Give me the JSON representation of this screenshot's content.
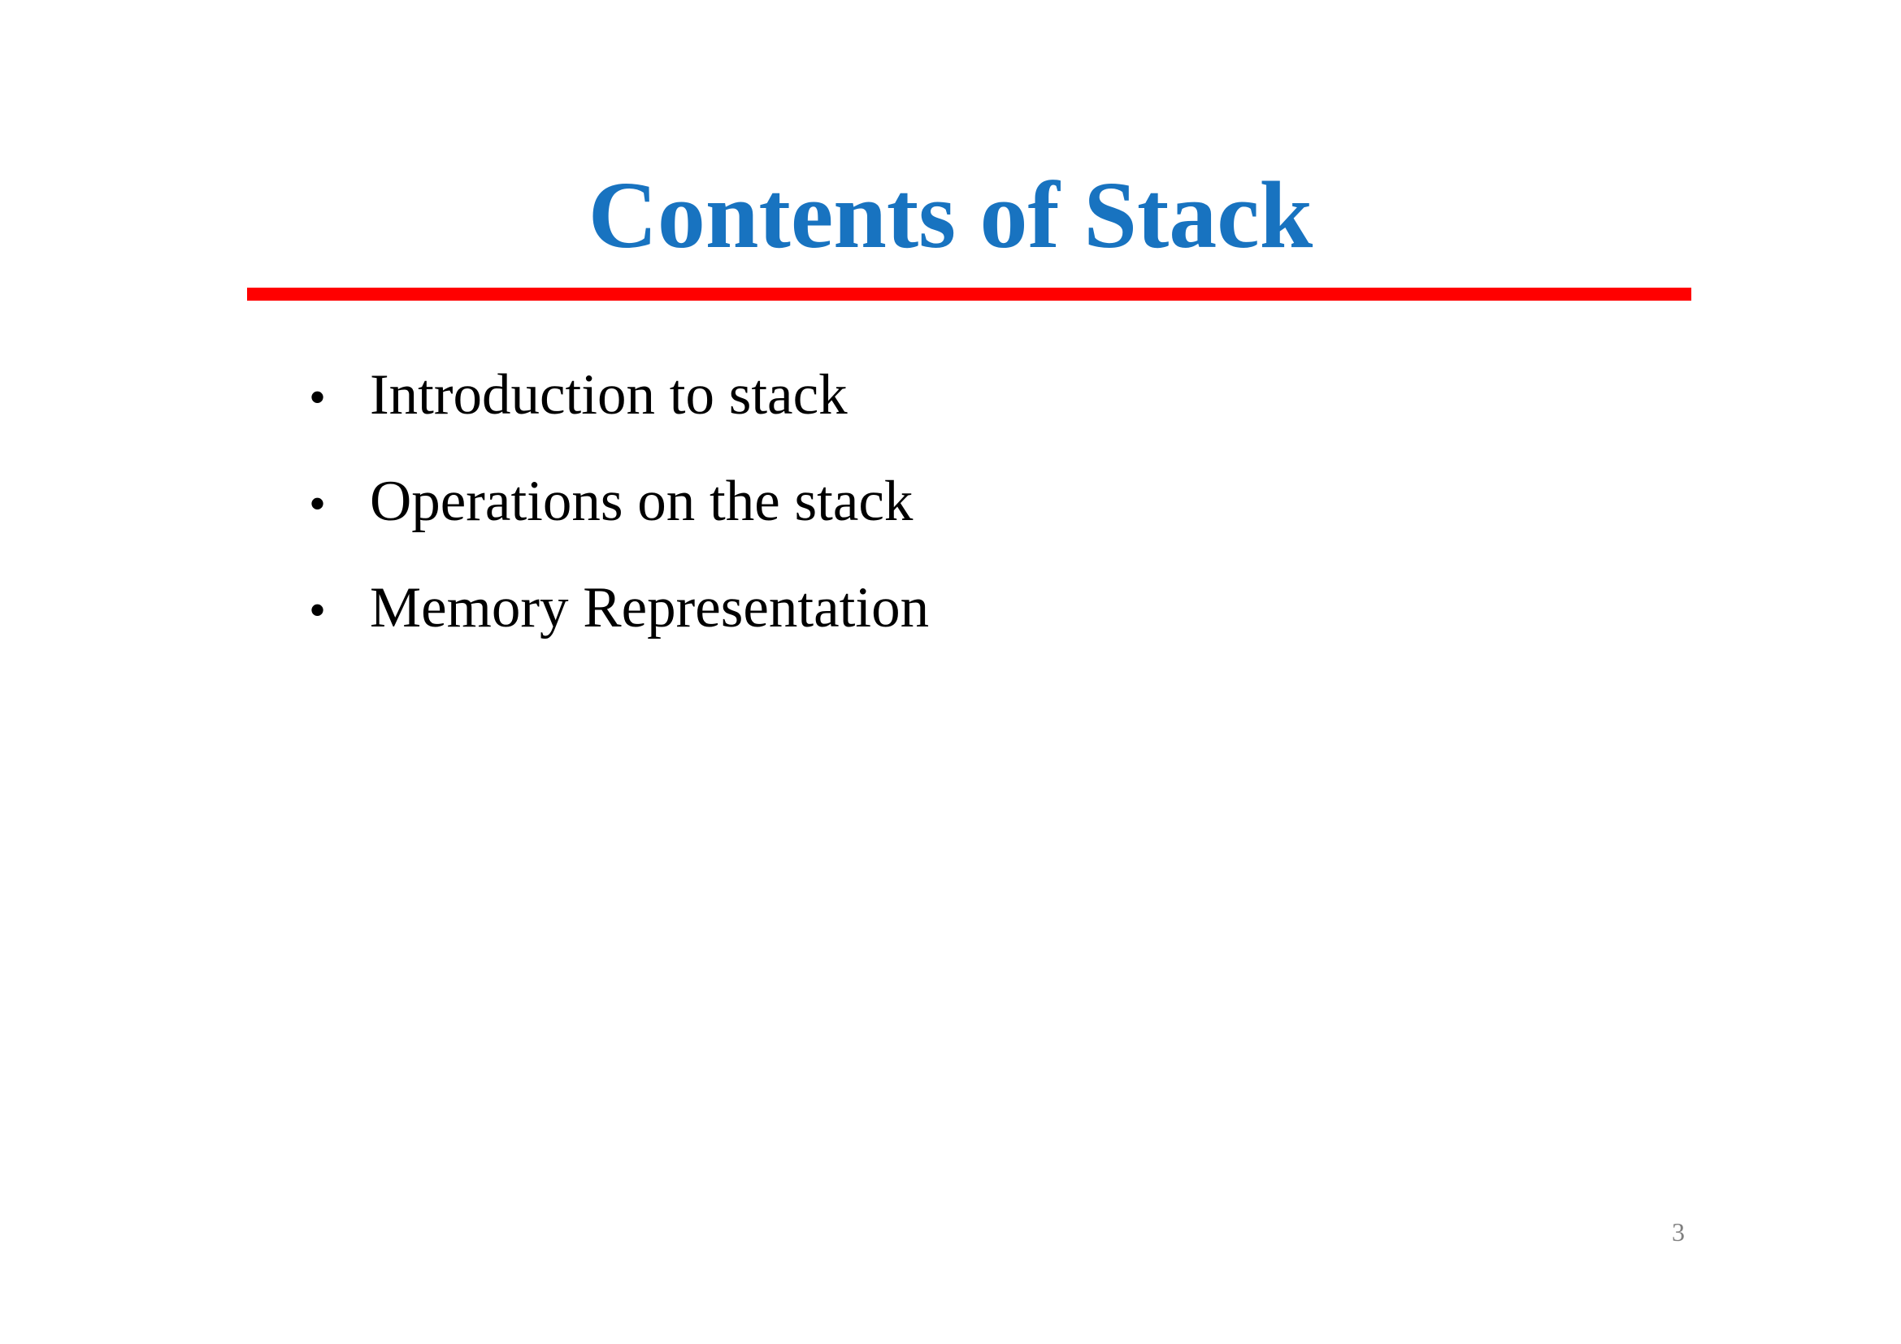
{
  "slide": {
    "title": "Contents of Stack",
    "bullets": [
      "Introduction to stack",
      "Operations on the stack",
      "Memory Representation"
    ],
    "bullet_marker": "•",
    "page_number": "3"
  },
  "colors": {
    "title": "#1873c0",
    "rule": "#ff0000",
    "body_text": "#000000",
    "page_number": "#7f7f7f"
  }
}
